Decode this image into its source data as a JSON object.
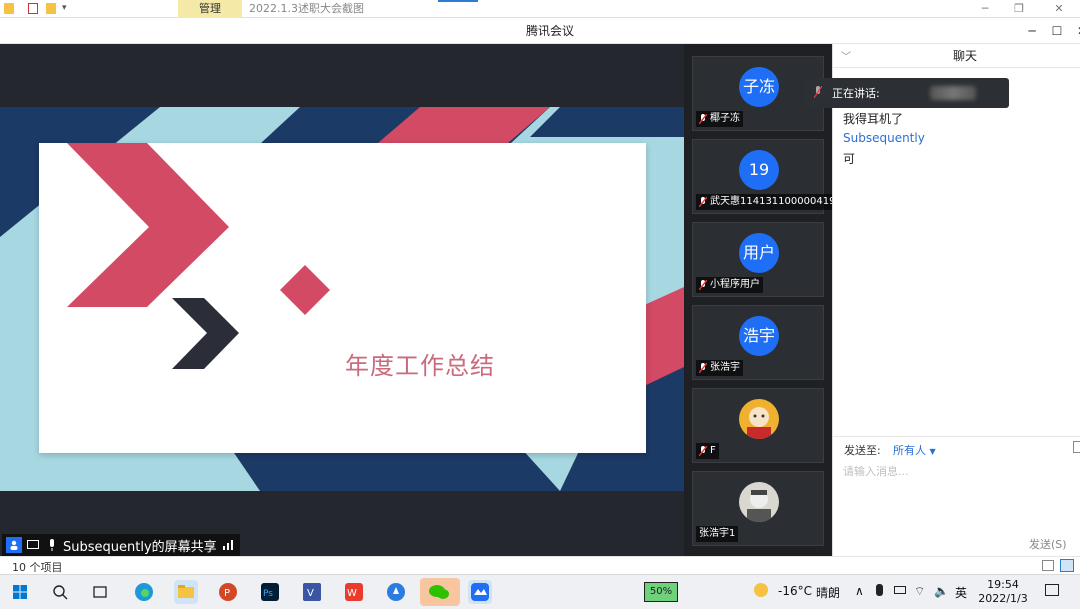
{
  "explorer": {
    "manage_tab": "管理",
    "title": "2022.1.3述职大会截图",
    "item_count": "10 个项目"
  },
  "meeting": {
    "window_title": "腾讯会议",
    "slide": {
      "title": "年度工作总结"
    },
    "share_status": "Subsequently的屏幕共享",
    "participants": [
      {
        "avatar": "子冻",
        "name": "椰子冻"
      },
      {
        "avatar": "19",
        "name": "武天惠114131100000419"
      },
      {
        "avatar": "用户",
        "name": "小程序用户"
      },
      {
        "avatar": "浩宇",
        "name": "张浩宇"
      },
      {
        "avatar": "",
        "name": "F"
      },
      {
        "avatar": "",
        "name": "张浩宇1"
      }
    ],
    "speaking_label": "正在讲话:"
  },
  "chat": {
    "title": "聊天",
    "messages": [
      {
        "text": "我得耳机了",
        "color": "#222222"
      },
      {
        "text": "Subsequently",
        "color": "#2b6fd6"
      },
      {
        "text": "可",
        "color": "#222222"
      }
    ],
    "send_to_label": "发送至:",
    "send_to_target": "所有人",
    "input_placeholder": "请输入消息...",
    "send_button": "发送(S)"
  },
  "taskbar": {
    "battery_widget": "50%",
    "weather_temp": "-16°C",
    "weather_text": "晴朗",
    "ime": "英",
    "time": "19:54",
    "date": "2022/1/3"
  },
  "colors": {
    "accent_blue": "#1e6ef6",
    "slide_pink": "#d24a64",
    "slide_navy": "#1c3a66",
    "slide_dark": "#2b2e38"
  }
}
